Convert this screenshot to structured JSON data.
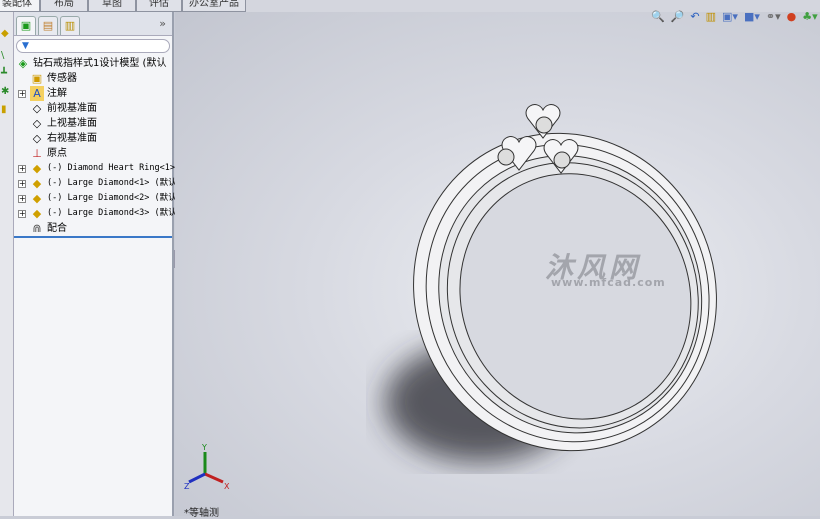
{
  "tabs": [
    "装配体",
    "布局",
    "草图",
    "评估",
    "办公室产品"
  ],
  "panel_tabs": {
    "feature_manager": "feature-manager-icon",
    "property_manager": "property-manager-icon",
    "configuration_manager": "configuration-manager-icon",
    "expand": "»"
  },
  "filter": {
    "icon": "▼"
  },
  "tree": {
    "root": "钻石戒指样式1设计模型  (默认",
    "items": [
      {
        "label": "传感器",
        "icon": "sensor-folder-icon",
        "expand": false
      },
      {
        "label": "注解",
        "icon": "annotation-folder-icon",
        "expand": true
      },
      {
        "label": "前视基准面",
        "icon": "plane-icon",
        "expand": false
      },
      {
        "label": "上视基准面",
        "icon": "plane-icon",
        "expand": false
      },
      {
        "label": "右视基准面",
        "icon": "plane-icon",
        "expand": false
      },
      {
        "label": "原点",
        "icon": "origin-icon",
        "expand": false
      },
      {
        "label": "(-) Diamond Heart Ring<1>",
        "icon": "part-icon",
        "expand": true
      },
      {
        "label": "(-) Large Diamond<1> (默认",
        "icon": "part-icon",
        "expand": true
      },
      {
        "label": "(-) Large Diamond<2> (默认",
        "icon": "part-icon",
        "expand": true
      },
      {
        "label": "(-) Large Diamond<3> (默认",
        "icon": "part-icon",
        "expand": true
      },
      {
        "label": "配合",
        "icon": "mates-icon",
        "expand": false
      }
    ]
  },
  "view": {
    "name": "*等轴测",
    "triad": {
      "x": "X",
      "y": "Y",
      "z": "Z"
    }
  },
  "watermark": {
    "text": "沐风网",
    "url": "www.mfcad.com"
  },
  "colors": {
    "viewport": "#d8dae2",
    "selection": "#3a78c8"
  }
}
